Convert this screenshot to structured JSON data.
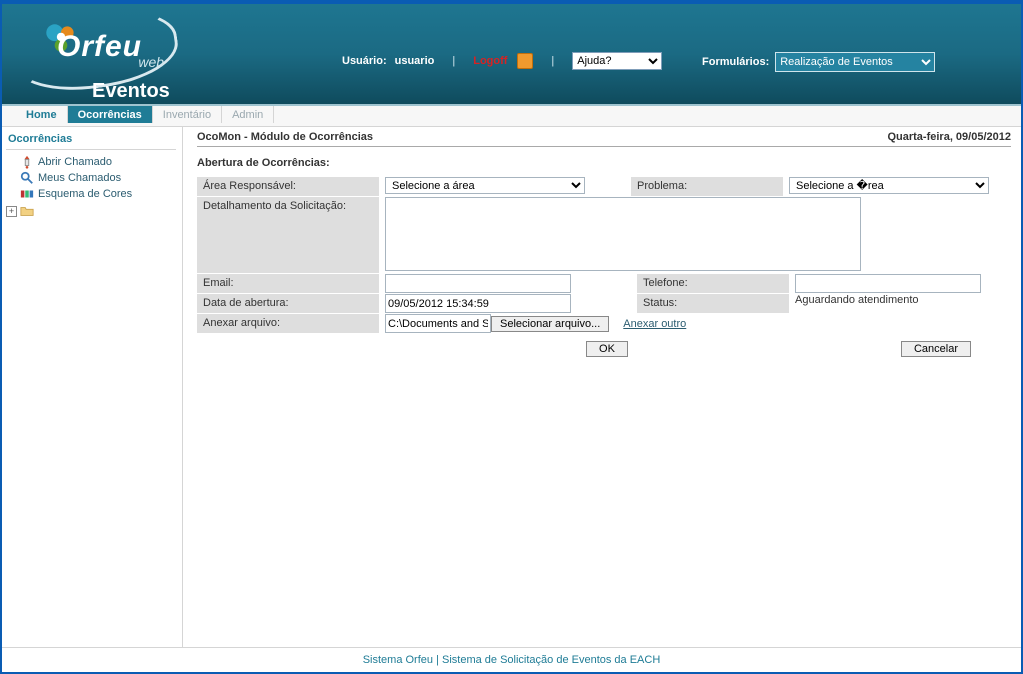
{
  "header": {
    "logo_main": "Orfeu",
    "logo_sub": "web",
    "logo_module": "Eventos",
    "user_label": "Usuário:",
    "user_value": "usuario",
    "logoff_label": "Logoff",
    "help_selected": "Ajuda?",
    "formularios_label": "Formulários:",
    "formularios_selected": "Realização de Eventos"
  },
  "nav": {
    "tabs": [
      {
        "label": "Home"
      },
      {
        "label": "Ocorrências"
      },
      {
        "label": "Inventário"
      },
      {
        "label": "Admin"
      }
    ]
  },
  "sidebar": {
    "title": "Ocorrências",
    "items": [
      {
        "label": "Abrir Chamado"
      },
      {
        "label": "Meus Chamados"
      },
      {
        "label": "Esquema de Cores"
      }
    ]
  },
  "main": {
    "module_title": "OcoMon - Módulo de Ocorrências",
    "date_text": "Quarta-feira, 09/05/2012",
    "section_title": "Abertura de Ocorrências:",
    "labels": {
      "area": "Área Responsável:",
      "problema": "Problema:",
      "detalhamento": "Detalhamento da Solicitação:",
      "email": "Email:",
      "telefone": "Telefone:",
      "data_abertura": "Data de abertura:",
      "status": "Status:",
      "anexar": "Anexar arquivo:"
    },
    "values": {
      "area_option": "Selecione a área",
      "problema_option": "Selecione a �rea",
      "email": "",
      "telefone": "",
      "data_abertura": "09/05/2012 15:34:59",
      "status": "Aguardando atendimento",
      "file_path": "C:\\Documents and Settin",
      "browse_label": "Selecionar arquivo...",
      "anexar_outro": "Anexar outro",
      "ok": "OK",
      "cancel": "Cancelar"
    }
  },
  "footer": {
    "text_left": "Sistema Orfeu",
    "text_sep": " | ",
    "text_right": "Sistema de Solicitação de Eventos da EACH"
  }
}
